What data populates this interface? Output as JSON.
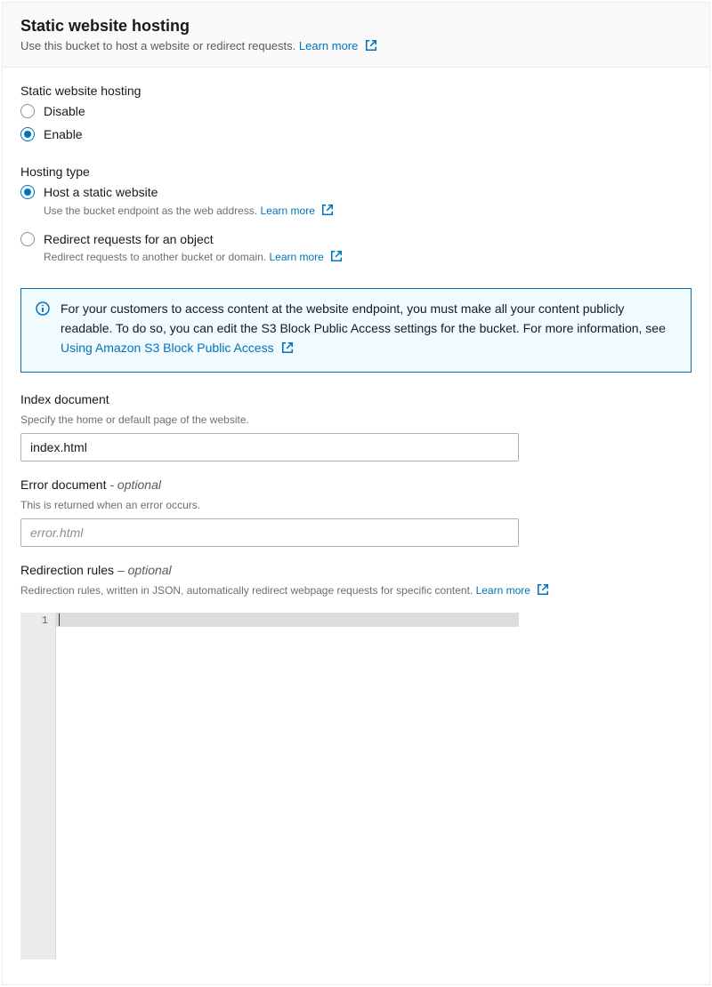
{
  "header": {
    "title": "Static website hosting",
    "subtitle": "Use this bucket to host a website or redirect requests.",
    "learn_more": "Learn more"
  },
  "hosting_toggle": {
    "label": "Static website hosting",
    "options": {
      "disable": "Disable",
      "enable": "Enable"
    }
  },
  "hosting_type": {
    "label": "Hosting type",
    "static": {
      "title": "Host a static website",
      "desc": "Use the bucket endpoint as the web address.",
      "learn_more": "Learn more"
    },
    "redirect": {
      "title": "Redirect requests for an object",
      "desc": "Redirect requests to another bucket or domain.",
      "learn_more": "Learn more"
    }
  },
  "info_box": {
    "text": "For your customers to access content at the website endpoint, you must make all your content publicly readable. To do so, you can edit the S3 Block Public Access settings for the bucket. For more information, see ",
    "link": "Using Amazon S3 Block Public Access"
  },
  "index_doc": {
    "label": "Index document",
    "help": "Specify the home or default page of the website.",
    "value": "index.html"
  },
  "error_doc": {
    "label_main": "Error document",
    "label_optional": " - optional",
    "help": "This is returned when an error occurs.",
    "placeholder": "error.html",
    "value": ""
  },
  "redir_rules": {
    "label_main": "Redirection rules",
    "label_optional": " – optional",
    "help": "Redirection rules, written in JSON, automatically redirect webpage requests for specific content.",
    "learn_more": "Learn more"
  },
  "editor": {
    "line_number": "1"
  }
}
